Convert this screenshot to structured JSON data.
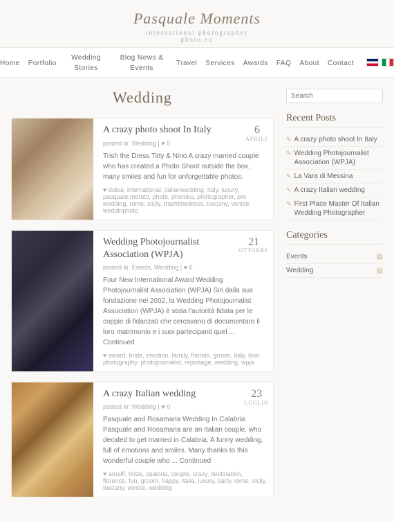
{
  "site": {
    "title": "Pasquale Moments",
    "subtitle": "international photographer\nPhoto.eu"
  },
  "nav": {
    "items": [
      {
        "label": "Home"
      },
      {
        "label": "Portfolio"
      },
      {
        "label": "Wedding Stories"
      },
      {
        "label": "Blog News & Events"
      },
      {
        "label": "Travel"
      },
      {
        "label": "Services"
      },
      {
        "label": "Awards"
      },
      {
        "label": "FAQ"
      },
      {
        "label": "About"
      },
      {
        "label": "Contact"
      }
    ]
  },
  "page": {
    "heading": "Wedding"
  },
  "posts": [
    {
      "title": "A crazy photo shoot In Italy",
      "date_day": "6",
      "date_month": "APRILE",
      "meta": "posted in: Wedding | ♥ 0",
      "excerpt": "Trish the Dress Titty & Nino   A crazy married couple who has created a  Photo Shoot outside the box, many smiles and fun for unforgettable photos.",
      "tags": "♥ dubai, international, italianwedding, italy, luxury, pasquale.moretti, photo, photoku, photographer, pre wedding, rome, sicily, trashtthedress, tuscany, venice, weddinphoto",
      "thumb_class": "thumb-wedding1"
    },
    {
      "title": "Wedding Photojournalist Association (WPJA)",
      "date_day": "21",
      "date_month": "OTTOBRE",
      "meta": "posted in: Events, Wedding | ♥ 6",
      "excerpt": "Four New International Award Wedding Photojournalist Association (WPJA) Sin dalla sua fondazione nel 2002, la Wedding Photojournalist Association (WPJA) è stata l'autorità fidata per le coppie di fidanzati che cercavano di documentare il loro matrimonio e i suoi partecipanti quel ... Continued",
      "tags": "♥ award, bride, emotion, family, friends, groom, italy, love, photography, photojournalist, reportage, wedding, wpja",
      "thumb_class": "thumb-wedding2"
    },
    {
      "title": "A crazy Italian wedding",
      "date_day": "23",
      "date_month": "LUGLIO",
      "meta": "posted in: Wedding | ♥ 0",
      "excerpt": "Pasquale and Rosamaria Wedding In Calabria      Pasquale and Rosamaria are an Italian couple, who decided to get married in Calabria. A funny wedding, full of emotions and smiles. Many thanks to this wonderful couple who ... Continued",
      "tags": "♥ amalfi, bride, calabria, couple, crazy, destination, florence, fun, groom, happy, italia, luxury, party, rome, sicily, tuscany, venice, wedding",
      "thumb_class": "thumb-wedding3"
    }
  ],
  "sidebar": {
    "search_placeholder": "Search",
    "recent_posts_title": "Recent Posts",
    "recent_posts": [
      {
        "label": "A crazy photo shoot In Italy"
      },
      {
        "label": "Wedding Photojournalist Association (WPJA)"
      },
      {
        "label": "La Vara di Messina"
      },
      {
        "label": "A crazy Italian wedding"
      },
      {
        "label": "First Place Master Of Italian Wedding Photographer"
      }
    ],
    "categories_title": "Categories",
    "categories": [
      {
        "label": "Events"
      },
      {
        "label": "Wedding"
      }
    ]
  }
}
